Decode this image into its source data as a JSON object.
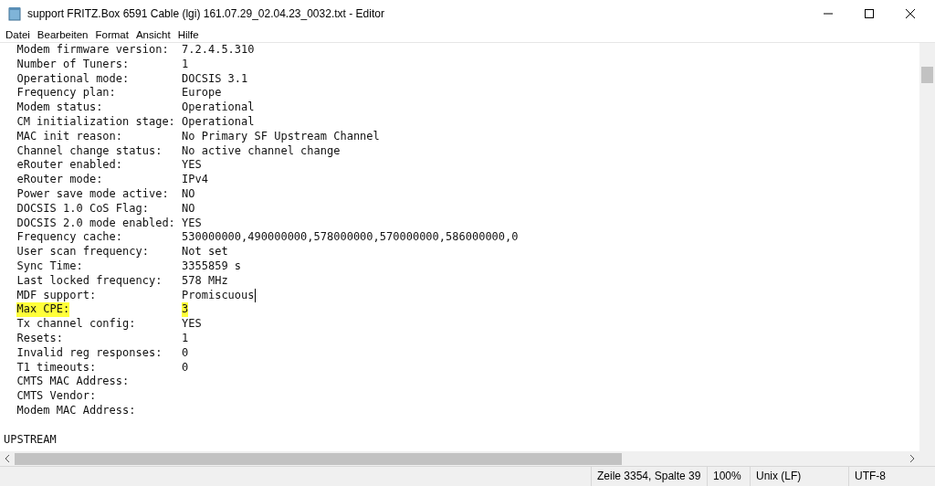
{
  "window": {
    "title": "support FRITZ.Box 6591 Cable (lgi) 161.07.29_02.04.23_0032.txt - Editor"
  },
  "menu": [
    "Datei",
    "Bearbeiten",
    "Format",
    "Ansicht",
    "Hilfe"
  ],
  "lines": [
    {
      "kind": "field",
      "label": "Modem firmware version:",
      "value": "7.2.4.5.310",
      "highlighted": false,
      "cursor": false
    },
    {
      "kind": "field",
      "label": "Number of Tuners:",
      "value": "1",
      "highlighted": false,
      "cursor": false
    },
    {
      "kind": "field",
      "label": "Operational mode:",
      "value": "DOCSIS 3.1",
      "highlighted": false,
      "cursor": false
    },
    {
      "kind": "field",
      "label": "Frequency plan:",
      "value": "Europe",
      "highlighted": false,
      "cursor": false
    },
    {
      "kind": "field",
      "label": "Modem status:",
      "value": "Operational",
      "highlighted": false,
      "cursor": false
    },
    {
      "kind": "field",
      "label": "CM initialization stage:",
      "value": "Operational",
      "highlighted": false,
      "cursor": false
    },
    {
      "kind": "field",
      "label": "MAC init reason:",
      "value": "No Primary SF Upstream Channel",
      "highlighted": false,
      "cursor": false
    },
    {
      "kind": "field",
      "label": "Channel change status:",
      "value": "No active channel change",
      "highlighted": false,
      "cursor": false
    },
    {
      "kind": "field",
      "label": "eRouter enabled:",
      "value": "YES",
      "highlighted": false,
      "cursor": false
    },
    {
      "kind": "field",
      "label": "eRouter mode:",
      "value": "IPv4",
      "highlighted": false,
      "cursor": false
    },
    {
      "kind": "field",
      "label": "Power save mode active:",
      "value": "NO",
      "highlighted": false,
      "cursor": false
    },
    {
      "kind": "field",
      "label": "DOCSIS 1.0 CoS Flag:",
      "value": "NO",
      "highlighted": false,
      "cursor": false
    },
    {
      "kind": "field",
      "label": "DOCSIS 2.0 mode enabled:",
      "value": "YES",
      "highlighted": false,
      "cursor": false
    },
    {
      "kind": "field",
      "label": "Frequency cache:",
      "value": "530000000,490000000,578000000,570000000,586000000,0",
      "highlighted": false,
      "cursor": false
    },
    {
      "kind": "field",
      "label": "User scan frequency:",
      "value": "Not set",
      "highlighted": false,
      "cursor": false
    },
    {
      "kind": "field",
      "label": "Sync Time:",
      "value": "3355859 s",
      "highlighted": false,
      "cursor": false
    },
    {
      "kind": "field",
      "label": "Last locked frequency:",
      "value": "578 MHz",
      "highlighted": false,
      "cursor": false
    },
    {
      "kind": "field",
      "label": "MDF support:",
      "value": "Promiscuous",
      "highlighted": false,
      "cursor": true
    },
    {
      "kind": "field",
      "label": "Max CPE:",
      "value": "3",
      "highlighted": true,
      "cursor": false
    },
    {
      "kind": "field",
      "label": "Tx channel config:",
      "value": "YES",
      "highlighted": false,
      "cursor": false
    },
    {
      "kind": "field",
      "label": "Resets:",
      "value": "1",
      "highlighted": false,
      "cursor": false
    },
    {
      "kind": "field",
      "label": "Invalid reg responses:",
      "value": "0",
      "highlighted": false,
      "cursor": false
    },
    {
      "kind": "field",
      "label": "T1 timeouts:",
      "value": "0",
      "highlighted": false,
      "cursor": false
    },
    {
      "kind": "field",
      "label": "CMTS MAC Address:",
      "highlighted": false,
      "cursor": false
    },
    {
      "kind": "field",
      "label": "CMTS Vendor:",
      "highlighted": false,
      "cursor": false
    },
    {
      "kind": "field",
      "label": "Modem MAC Address:",
      "highlighted": false,
      "cursor": false
    },
    {
      "kind": "blank"
    },
    {
      "kind": "section",
      "label": "UPSTREAM"
    }
  ],
  "status_bar": [
    "Zeile 3354, Spalte 39",
    "100%",
    "Unix (LF)",
    "UTF-8"
  ]
}
